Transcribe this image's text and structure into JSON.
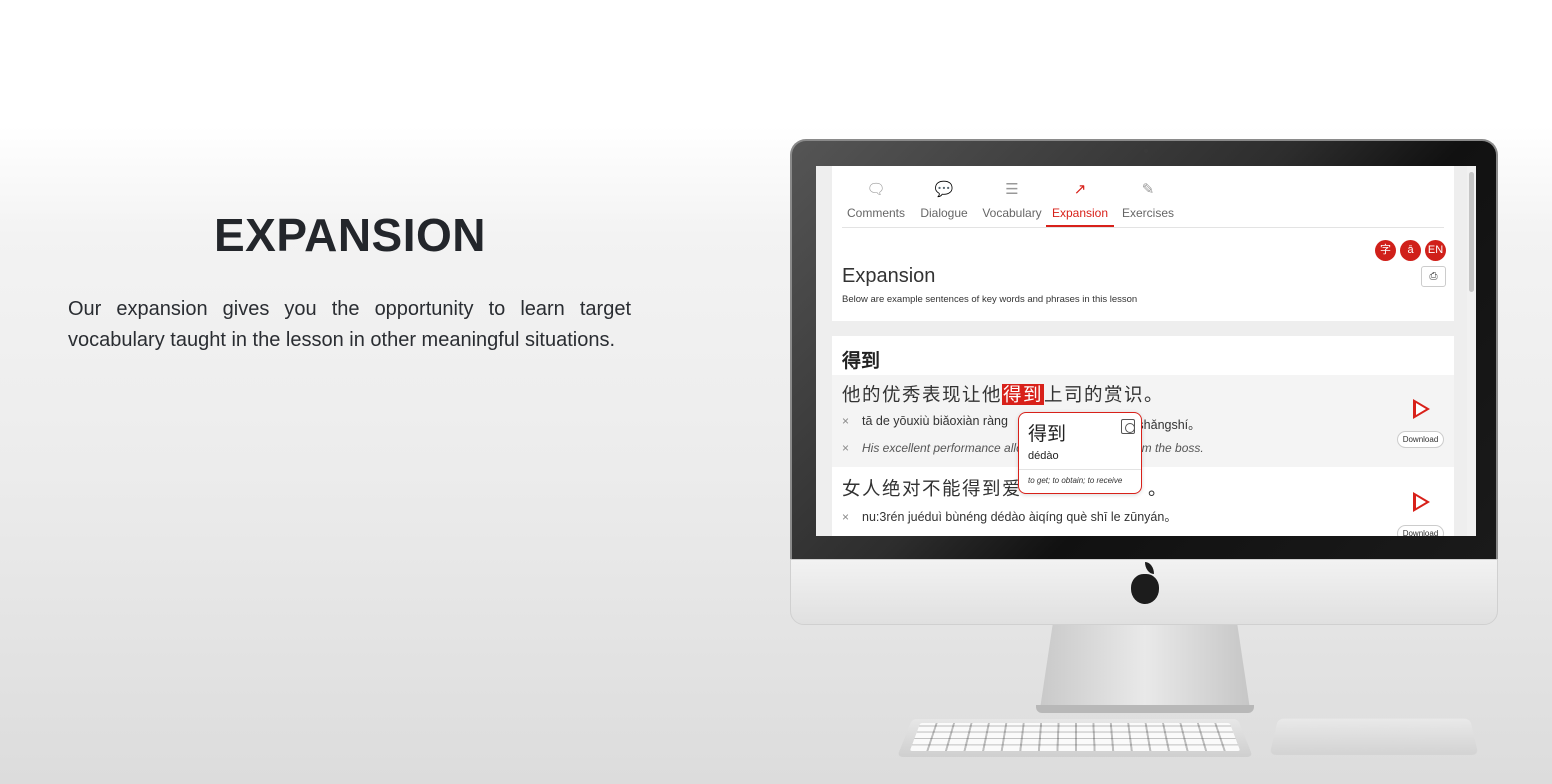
{
  "hero": {
    "title": "EXPANSION",
    "description": "Our expansion gives you the opportunity to learn target vocabulary taught in the lesson in other meaningful situations."
  },
  "app": {
    "tabs": [
      {
        "label": "Comments",
        "icon": "comment-icon"
      },
      {
        "label": "Dialogue",
        "icon": "dialogue-icon"
      },
      {
        "label": "Vocabulary",
        "icon": "vocabulary-icon"
      },
      {
        "label": "Expansion",
        "icon": "expansion-icon",
        "active": true
      },
      {
        "label": "Exercises",
        "icon": "exercises-icon"
      }
    ],
    "lang_buttons": [
      "字",
      "ā",
      "EN"
    ],
    "section_title": "Expansion",
    "section_subtitle": "Below are example sentences of key words and phrases in this lesson",
    "print_icon": "print-icon",
    "word_heading": "得到",
    "sentences": [
      {
        "zh_before": "他的优秀表现让他",
        "zh_highlight": "得到",
        "zh_after": "上司的赏识。",
        "pinyin": "tā de yōuxiù biǎoxiàn ràng",
        "pinyin_tail": "e shǎngshí。",
        "english": "His excellent performance allow",
        "english_tail": "rom the boss.",
        "download_label": "Download"
      },
      {
        "zh_before": "女人绝对不能得到爱",
        "zh_after": "。",
        "pinyin": "nu:3rén juéduì bùnéng dédào àiqíng què shī le zūnyán。",
        "download_label": "Download"
      }
    ],
    "popup": {
      "word": "得到",
      "pinyin": "dédào",
      "definition": "to get; to obtain; to receive"
    }
  },
  "colors": {
    "accent": "#d8211a",
    "title": "#23262b"
  }
}
